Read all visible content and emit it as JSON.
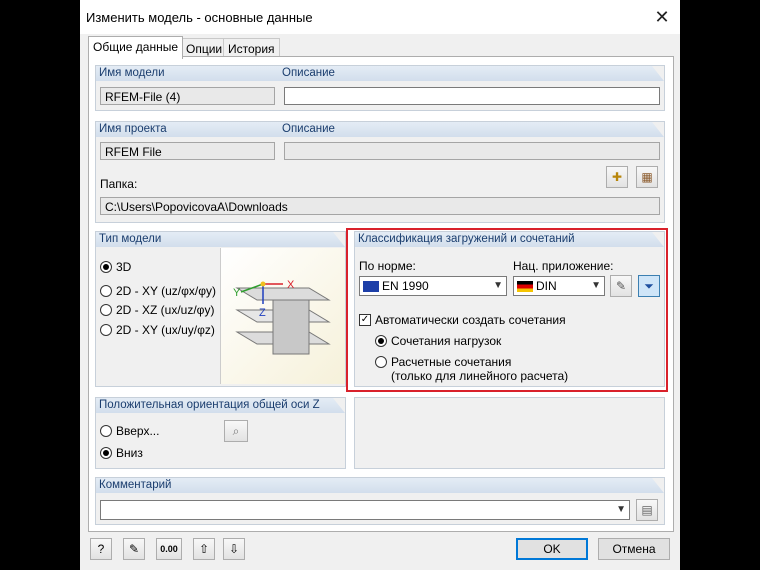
{
  "window": {
    "title": "Изменить модель - основные данные"
  },
  "tabs": [
    {
      "label": "Общие данные",
      "active": true
    },
    {
      "label": "Опции",
      "active": false
    },
    {
      "label": "История",
      "active": false
    }
  ],
  "model": {
    "name_label": "Имя модели",
    "name_value": "RFEM-File (4)",
    "desc_label": "Описание",
    "desc_value": ""
  },
  "project": {
    "name_label": "Имя проекта",
    "name_value": "RFEM File",
    "desc_label": "Описание",
    "desc_value": "",
    "folder_label": "Папка:",
    "folder_value": "C:\\Users\\PopovicovaA\\Downloads"
  },
  "model_type": {
    "header": "Тип модели",
    "options": [
      {
        "label": "3D",
        "selected": true
      },
      {
        "label": "2D - XY (uz/φx/φy)",
        "selected": false
      },
      {
        "label": "2D - XZ (ux/uz/φy)",
        "selected": false
      },
      {
        "label": "2D - XY (ux/uy/φz)",
        "selected": false
      }
    ],
    "axis_labels": {
      "x": "X",
      "y": "Y",
      "z": "Z"
    }
  },
  "classification": {
    "header": "Классификация загружений и сочетаний",
    "norm_label": "По норме:",
    "norm_value": "EN 1990",
    "annex_label": "Нац. приложение:",
    "annex_value": "DIN",
    "auto_combo_label": "Автоматически создать сочетания",
    "auto_combo_checked": true,
    "combo_options": [
      {
        "label": "Сочетания нагрузок",
        "selected": true
      },
      {
        "label": "Расчетные сочетания",
        "sub": "(только для линейного расчета)",
        "selected": false
      }
    ]
  },
  "orientation": {
    "header": "Положительная ориентация общей оси Z",
    "options": [
      {
        "label": "Вверх...",
        "selected": false
      },
      {
        "label": "Вниз",
        "selected": true
      }
    ]
  },
  "comment": {
    "header": "Комментарий",
    "value": ""
  },
  "buttons": {
    "ok": "OK",
    "cancel": "Отмена",
    "units_label": "0.00"
  },
  "colors": {
    "accent": "#0078d7",
    "highlight": "#d9212b",
    "group_header": "#1a3d6e"
  }
}
